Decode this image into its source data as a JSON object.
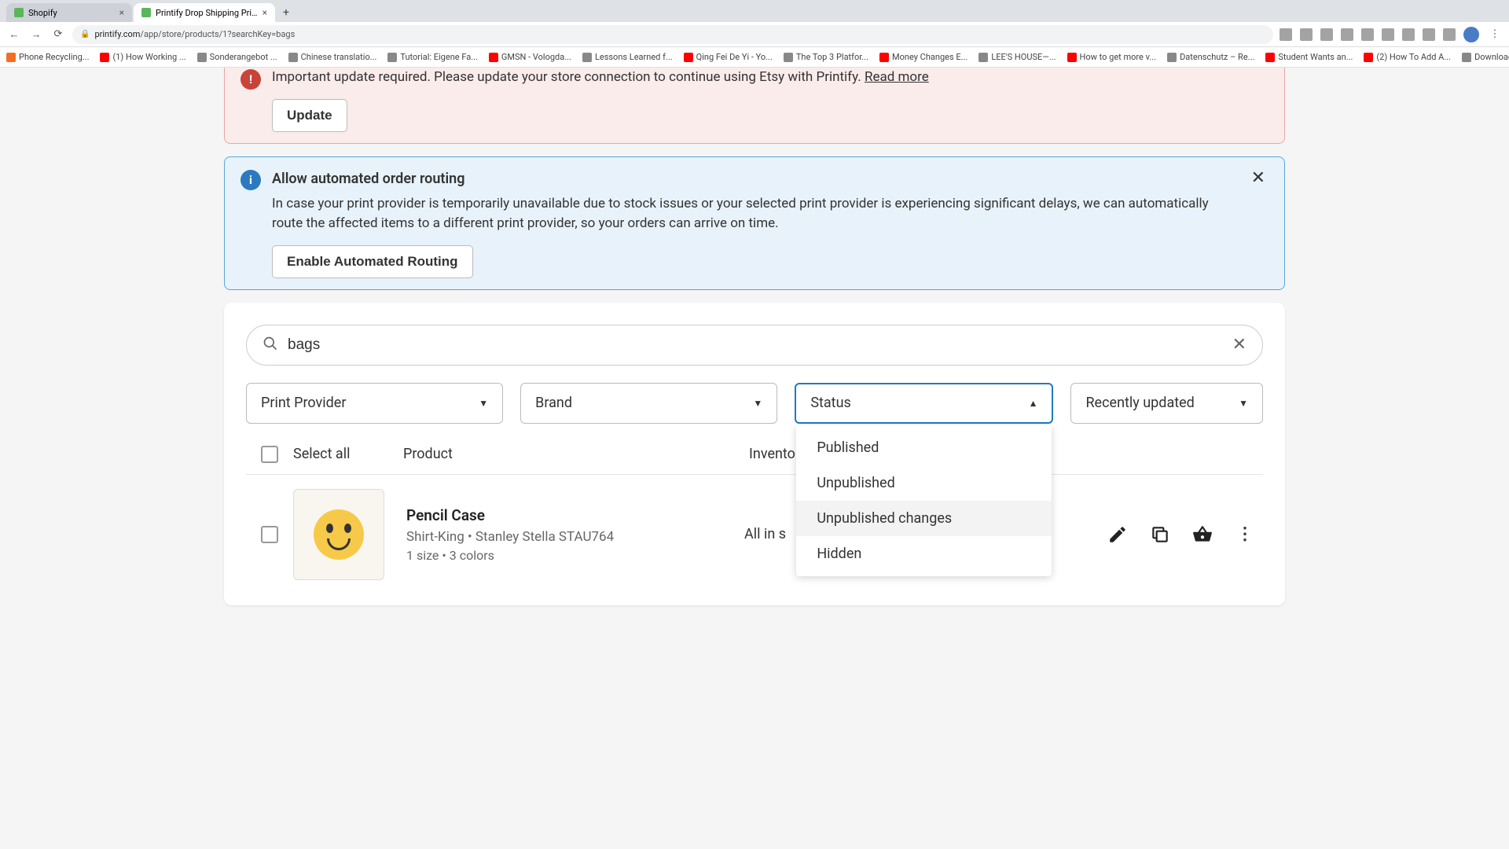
{
  "browser": {
    "tabs": [
      {
        "title": "Shopify"
      },
      {
        "title": "Printify Drop Shipping Print o..."
      }
    ],
    "url_domain": "printify.com",
    "url_path": "/app/store/products/1?searchKey=bags",
    "bookmarks": [
      "Phone Recycling...",
      "(1) How Working ...",
      "Sonderangebot ...",
      "Chinese translatio...",
      "Tutorial: Eigene Fa...",
      "GMSN - Vologda...",
      "Lessons Learned f...",
      "Qing Fei De Yi - Yo...",
      "The Top 3 Platfor...",
      "Money Changes E...",
      "LEE'S HOUSE—...",
      "How to get more v...",
      "Datenschutz – Re...",
      "Student Wants an...",
      "(2) How To Add A...",
      "Download - Cooki..."
    ]
  },
  "alerts": {
    "warning": {
      "text": "Important update required. Please update your store connection to continue using Etsy with Printify.",
      "read_more": "Read more",
      "button": "Update"
    },
    "info": {
      "title": "Allow automated order routing",
      "text": "In case your print provider is temporarily unavailable due to stock issues or your selected print provider is experiencing significant delays, we can automatically route the affected items to a different print provider, so your orders can arrive on time.",
      "button": "Enable Automated Routing"
    }
  },
  "search": {
    "value": "bags"
  },
  "filters": {
    "provider": "Print Provider",
    "brand": "Brand",
    "status": "Status",
    "sort": "Recently updated",
    "status_options": [
      "Published",
      "Unpublished",
      "Unpublished changes",
      "Hidden"
    ]
  },
  "table": {
    "select_all": "Select all",
    "headers": {
      "product": "Product",
      "inventory": "Inventory"
    }
  },
  "products": [
    {
      "name": "Pencil Case",
      "subtitle": "Shirt-King • Stanley Stella STAU764",
      "variants": "1 size • 3 colors",
      "inventory": "All in s"
    }
  ]
}
